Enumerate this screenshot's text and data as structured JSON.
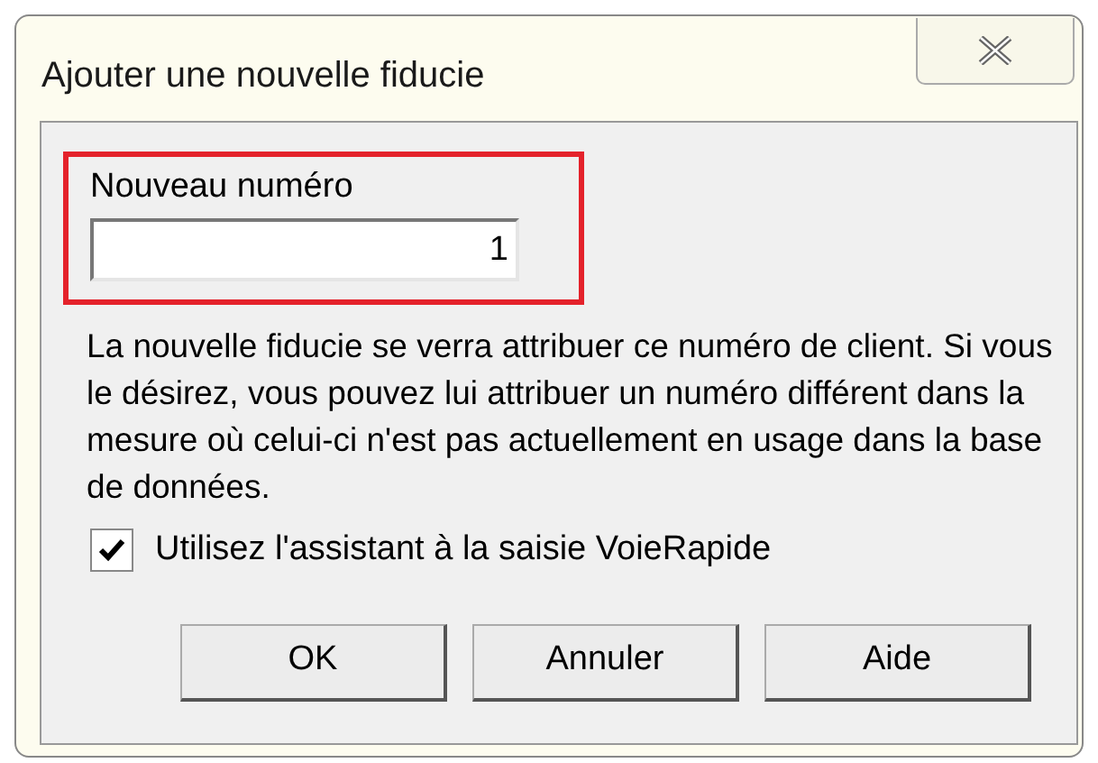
{
  "window": {
    "title": "Ajouter une nouvelle fiducie"
  },
  "number_field": {
    "label": "Nouveau numéro",
    "value": "1",
    "highlighted": true
  },
  "description": "La nouvelle fiducie se verra attribuer ce numéro de client. Si vous le désirez, vous pouvez lui attribuer un numéro différent dans la mesure où celui-ci n'est pas actuellement en usage dans la base de données.",
  "wizard_checkbox": {
    "label": "Utilisez l'assistant à la saisie VoieRapide",
    "checked": true
  },
  "buttons": [
    "OK",
    "Annuler",
    "Aide"
  ]
}
